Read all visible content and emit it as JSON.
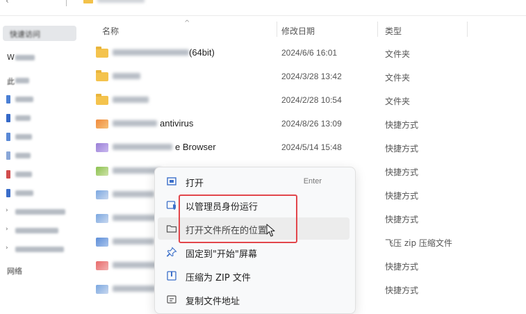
{
  "columns": {
    "name": "名称",
    "modified": "修改日期",
    "type": "类型"
  },
  "sidebar": {
    "quick_access": "快速访问",
    "items": [
      {
        "label": "W",
        "icon": "folder-icon"
      },
      {
        "label": "此",
        "icon": "pc-icon"
      }
    ],
    "network": "网络"
  },
  "rows": [
    {
      "name_visible": "(64bit)",
      "date": "2024/6/6 16:01",
      "type": "文件夹",
      "icon": "folder"
    },
    {
      "name_visible": "",
      "date": "2024/3/28 13:42",
      "type": "文件夹",
      "icon": "folder"
    },
    {
      "name_visible": "",
      "date": "2024/2/28 10:54",
      "type": "文件夹",
      "icon": "folder"
    },
    {
      "name_visible": "antivirus",
      "date": "2024/8/26 13:09",
      "type": "快捷方式",
      "icon": "shortcut"
    },
    {
      "name_visible": "e Browser",
      "date": "2024/5/14 15:48",
      "type": "快捷方式",
      "icon": "shortcut"
    },
    {
      "name_visible": "",
      "date": "",
      "type": "快捷方式",
      "icon": "shortcut"
    },
    {
      "name_visible": "",
      "date": "",
      "type": "快捷方式",
      "icon": "shortcut"
    },
    {
      "name_visible": "",
      "date": "",
      "type": "快捷方式",
      "icon": "shortcut"
    },
    {
      "name_visible": "",
      "date": "",
      "type": "飞压 zip 压缩文件",
      "icon": "shortcut"
    },
    {
      "name_visible": "",
      "date": "",
      "type": "快捷方式",
      "icon": "shortcut"
    },
    {
      "name_visible": "",
      "date": "",
      "type": "快捷方式",
      "icon": "shortcut"
    }
  ],
  "context_menu": {
    "open": "打开",
    "open_shortcut": "Enter",
    "run_as_admin": "以管理员身份运行",
    "open_file_location": "打开文件所在的位置",
    "pin_to_start": "固定到\"开始\"屏幕",
    "compress_zip": "压缩为 ZIP 文件",
    "copy_path": "复制文件地址"
  },
  "colors": {
    "highlight": "#e2464b",
    "folder": "#f4c34d"
  }
}
